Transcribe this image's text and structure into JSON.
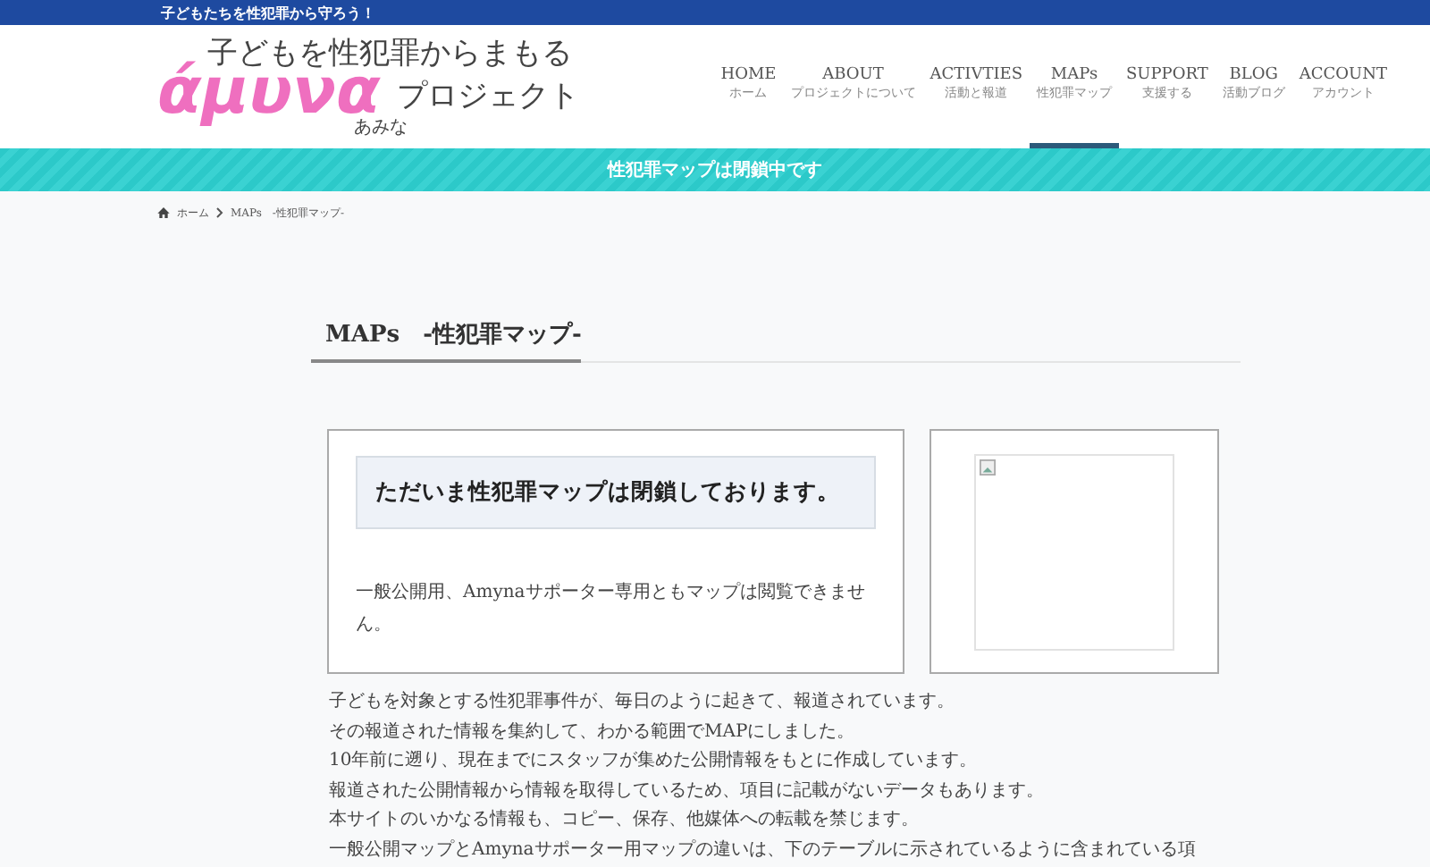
{
  "top_bar": {
    "tagline": "子どもたちを性犯罪から守ろう！"
  },
  "logo": {
    "top": "子どもを性犯罪からまもる",
    "main": "άμυνα",
    "reading": "あみな",
    "suffix": "プロジェクト"
  },
  "nav": [
    {
      "label": "HOME",
      "sub": "ホーム",
      "selected": false
    },
    {
      "label": "ABOUT",
      "sub": "プロジェクトについて",
      "selected": false
    },
    {
      "label": "ACTIVTIES",
      "sub": "活動と報道",
      "selected": false
    },
    {
      "label": "MAPs",
      "sub": "性犯罪マップ",
      "selected": true
    },
    {
      "label": "SUPPORT",
      "sub": "支援する",
      "selected": false
    },
    {
      "label": "BLOG",
      "sub": "活動ブログ",
      "selected": false
    },
    {
      "label": "ACCOUNT",
      "sub": "アカウント",
      "selected": false
    }
  ],
  "notice_banner": "性犯罪マップは閉鎖中です",
  "breadcrumb": [
    "ホーム",
    "MAPs　-性犯罪マップ-"
  ],
  "page_title": "MAPs　-性犯罪マップ-",
  "closed_box": {
    "heading": "ただいま性犯罪マップは閉鎖しております。",
    "text": "一般公開用、Amynaサポーター専用ともマップは閲覧できません。"
  },
  "image_box": {
    "kind": "broken-image"
  },
  "paragraphs": [
    "子どもを対象とする性犯罪事件が、毎日のように起きて、報道されています。",
    "その報道された情報を集約して、わかる範囲でMAPにしました。",
    "10年前に遡り、現在までにスタッフが集めた公開情報をもとに作成しています。",
    "報道された公開情報から情報を取得しているため、項目に記載がないデータもあります。",
    "本サイトのいかなる情報も、コピー、保存、他媒体への転載を禁じます。",
    "一般公開マップとAmynaサポーター用マップの違いは、下のテーブルに示されているように含まれている項"
  ]
}
